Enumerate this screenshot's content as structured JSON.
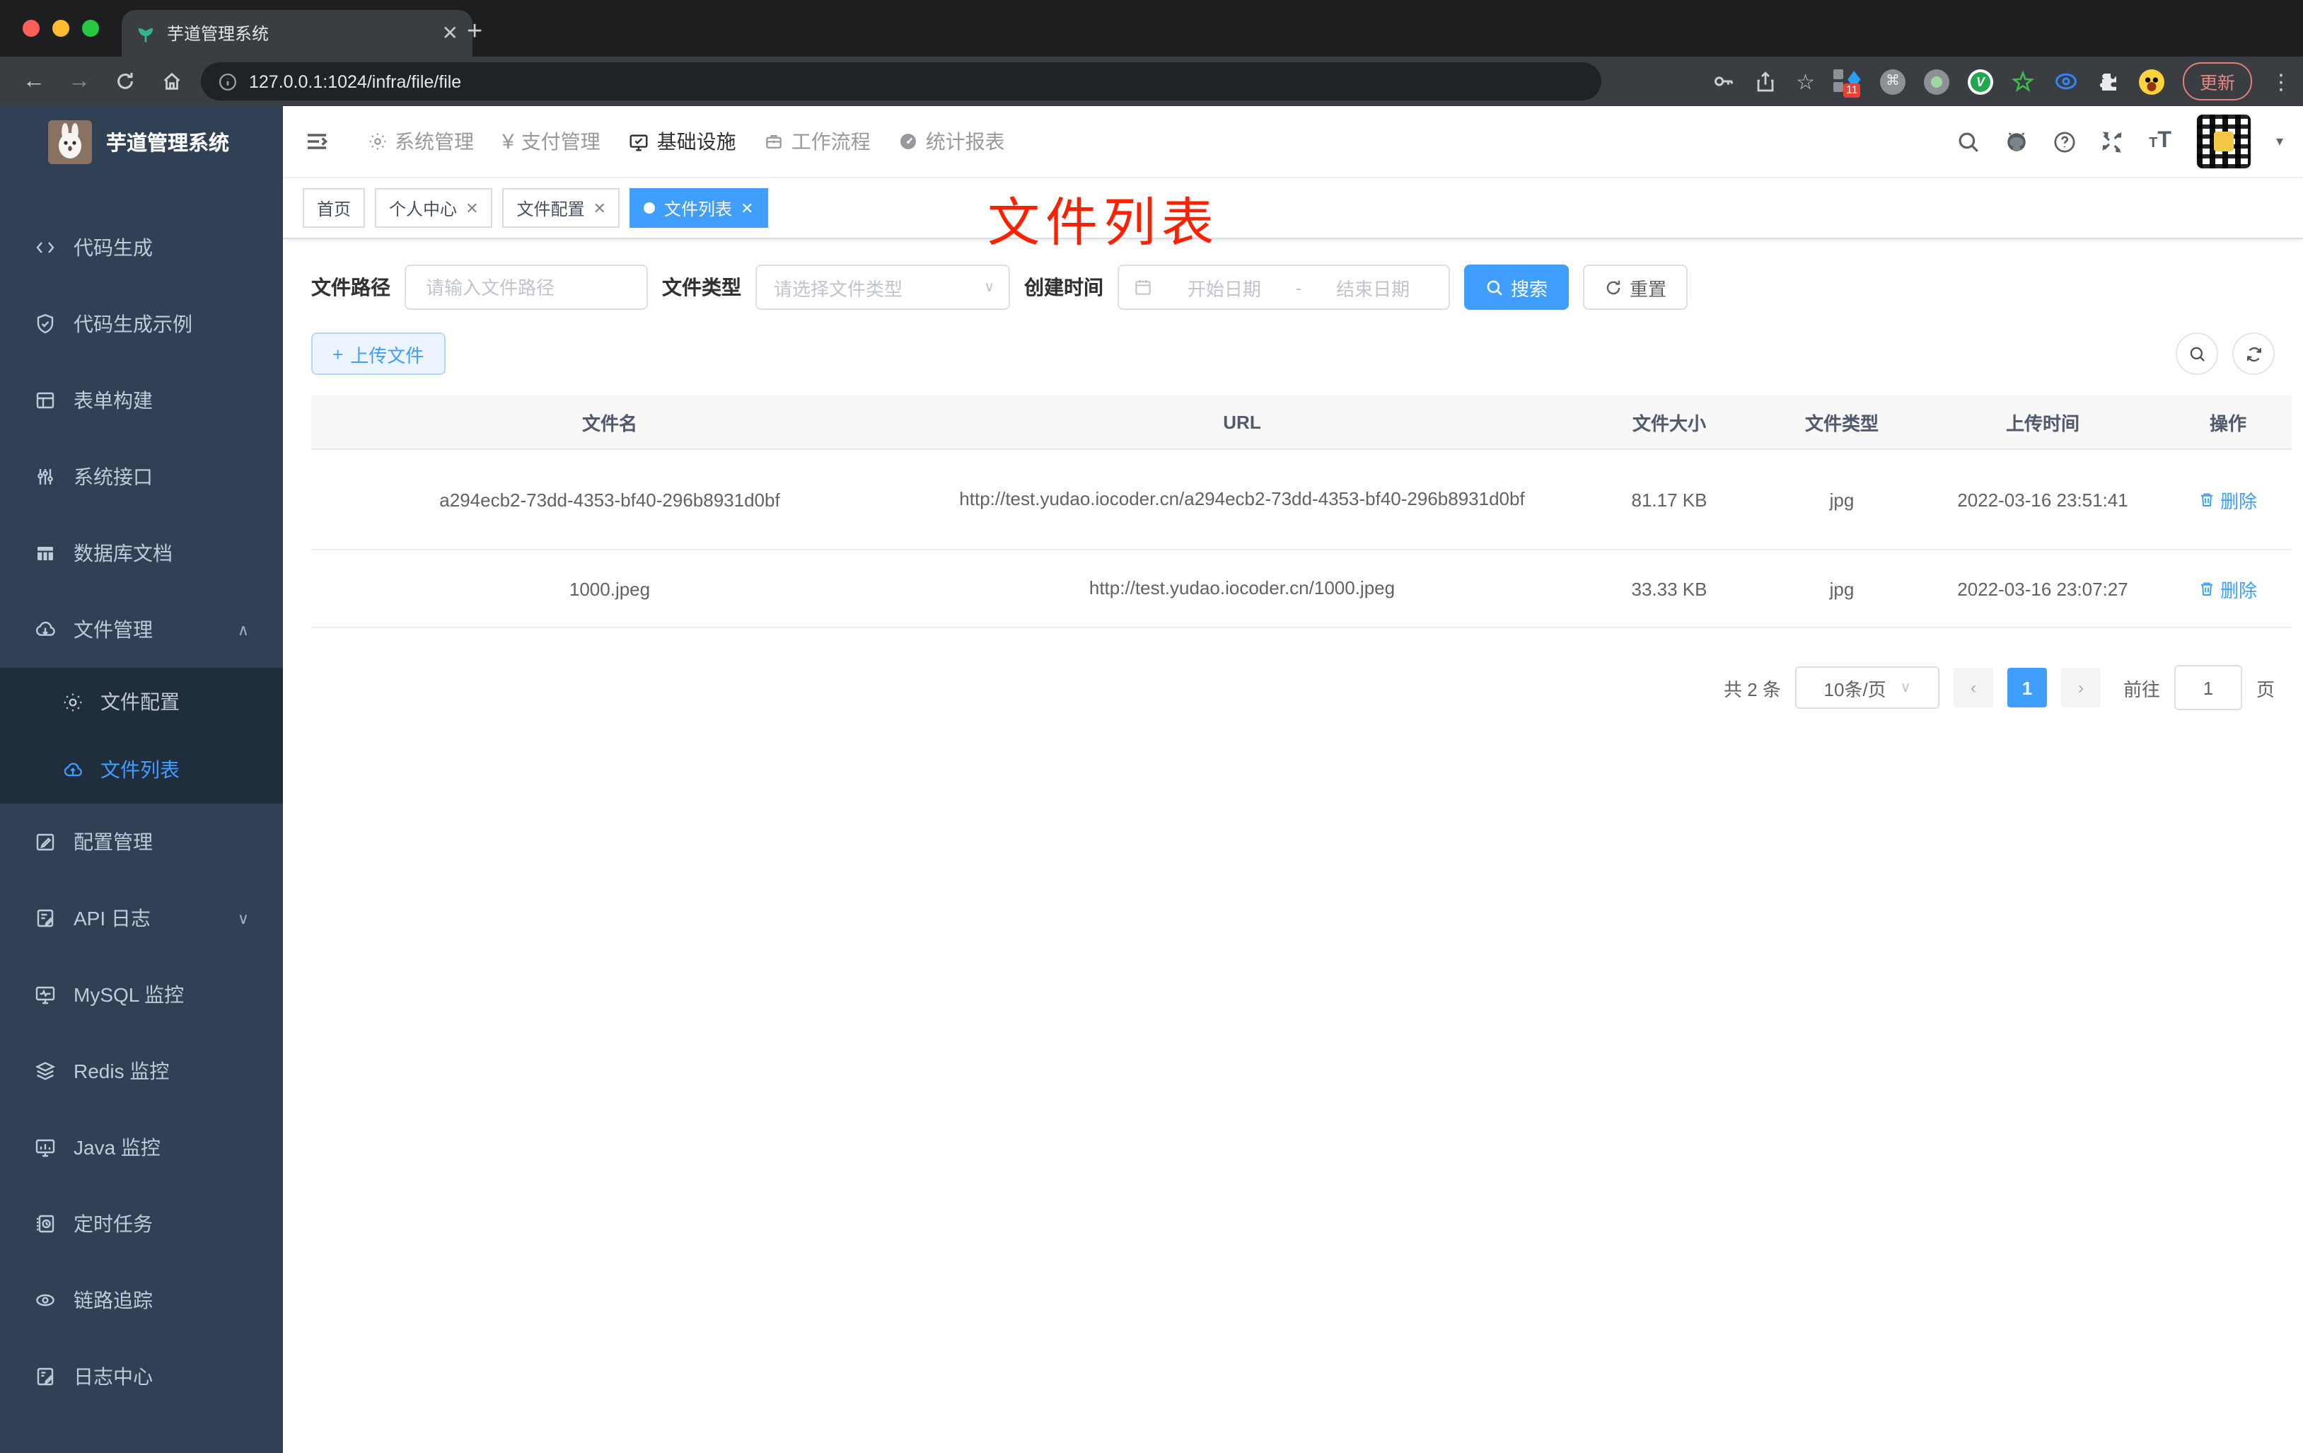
{
  "browser": {
    "tab_title": "芋道管理系统",
    "url": "127.0.0.1:1024/infra/file/file",
    "ext_badge": "11",
    "update_label": "更新",
    "new_tab": "+",
    "close_tab": "✕",
    "back": "←",
    "forward": "→",
    "more_dots": "⋮",
    "star": "☆",
    "cmd": "⌘"
  },
  "sidebar": {
    "logo_title": "芋道管理系统",
    "items": [
      {
        "label": "代码生成"
      },
      {
        "label": "代码生成示例"
      },
      {
        "label": "表单构建"
      },
      {
        "label": "系统接口"
      },
      {
        "label": "数据库文档"
      },
      {
        "label": "文件管理"
      },
      {
        "label": "文件配置"
      },
      {
        "label": "文件列表"
      },
      {
        "label": "配置管理"
      },
      {
        "label": "API 日志"
      },
      {
        "label": "MySQL 监控"
      },
      {
        "label": "Redis 监控"
      },
      {
        "label": "Java 监控"
      },
      {
        "label": "定时任务"
      },
      {
        "label": "链路追踪"
      },
      {
        "label": "日志中心"
      }
    ],
    "expand_chevron": "∧",
    "collapse_chevron": "∨"
  },
  "topnav": {
    "items": [
      {
        "label": "系统管理"
      },
      {
        "label": "支付管理"
      },
      {
        "label": "基础设施"
      },
      {
        "label": "工作流程"
      },
      {
        "label": "统计报表"
      }
    ],
    "yen_icon": "¥",
    "t_small": "T",
    "t_big": "T",
    "avatar_caret": "▾"
  },
  "tags": {
    "items": [
      {
        "label": "首页",
        "closable": false,
        "active": false
      },
      {
        "label": "个人中心",
        "closable": true,
        "active": false
      },
      {
        "label": "文件配置",
        "closable": true,
        "active": false
      },
      {
        "label": "文件列表",
        "closable": true,
        "active": true
      }
    ],
    "close_glyph": "✕"
  },
  "annotation": "文件列表",
  "filters": {
    "path_label": "文件路径",
    "path_placeholder": "请输入文件路径",
    "type_label": "文件类型",
    "type_placeholder": "请选择文件类型",
    "time_label": "创建时间",
    "start_placeholder": "开始日期",
    "range_separator": "-",
    "end_placeholder": "结束日期",
    "search_label": "搜索",
    "reset_label": "重置"
  },
  "toolbar": {
    "upload_label": "上传文件",
    "plus_glyph": "+"
  },
  "table": {
    "columns": [
      "文件名",
      "URL",
      "文件大小",
      "文件类型",
      "上传时间",
      "操作"
    ],
    "rows": [
      {
        "name": "a294ecb2-73dd-4353-bf40-296b8931d0bf",
        "url": "http://test.yudao.iocoder.cn/a294ecb2-73dd-4353-bf40-296b8931d0bf",
        "size": "81.17 KB",
        "type": "jpg",
        "time": "2022-03-16 23:51:41",
        "action": "删除"
      },
      {
        "name": "1000.jpeg",
        "url": "http://test.yudao.iocoder.cn/1000.jpeg",
        "size": "33.33 KB",
        "type": "jpg",
        "time": "2022-03-16 23:07:27",
        "action": "删除"
      }
    ]
  },
  "pagination": {
    "total": "共 2 条",
    "page_size": "10条/页",
    "prev": "‹",
    "next": "›",
    "current_page": "1",
    "goto_label": "前往",
    "goto_value": "1",
    "page_unit": "页"
  },
  "colors": {
    "accent": "#409eff",
    "sidebar_bg": "#304156",
    "submenu_bg": "#1f2d3d",
    "annotation_red": "#fe2000",
    "active_tag": "#409eff",
    "table_header_bg": "#f8f8f9"
  }
}
